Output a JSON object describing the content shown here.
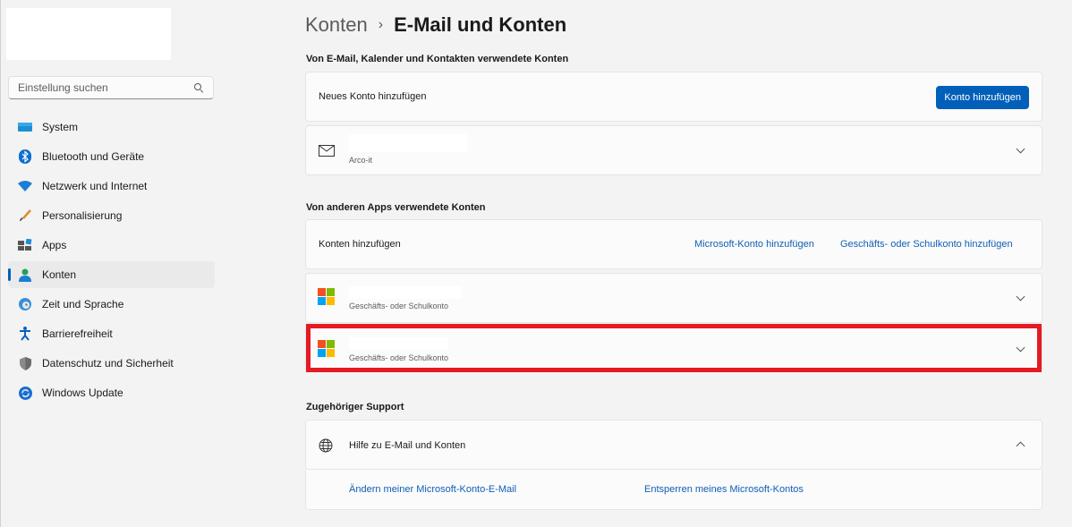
{
  "sidebar": {
    "search_placeholder": "Einstellung suchen",
    "items": [
      {
        "label": "System",
        "icon": "monitor-icon"
      },
      {
        "label": "Bluetooth und Geräte",
        "icon": "bluetooth-icon"
      },
      {
        "label": "Netzwerk und Internet",
        "icon": "wifi-icon"
      },
      {
        "label": "Personalisierung",
        "icon": "brush-icon"
      },
      {
        "label": "Apps",
        "icon": "apps-icon"
      },
      {
        "label": "Konten",
        "icon": "person-icon",
        "active": true
      },
      {
        "label": "Zeit und Sprache",
        "icon": "globe-clock-icon"
      },
      {
        "label": "Barrierefreiheit",
        "icon": "accessibility-icon"
      },
      {
        "label": "Datenschutz und Sicherheit",
        "icon": "shield-icon"
      },
      {
        "label": "Windows Update",
        "icon": "update-icon"
      }
    ]
  },
  "header": {
    "parent": "Konten",
    "separator": "›",
    "current": "E-Mail und Konten"
  },
  "sections": {
    "email_accounts_title": "Von E-Mail, Kalender und Kontakten verwendete Konten",
    "other_apps_title": "Von anderen Apps verwendete Konten",
    "support_title": "Zugehöriger Support"
  },
  "email": {
    "add_label": "Neues Konto hinzufügen",
    "add_button": "Konto hinzufügen",
    "account_sub": "Arco-it"
  },
  "other_apps": {
    "add_label": "Konten hinzufügen",
    "ms_link": "Microsoft-Konto hinzufügen",
    "work_link": "Geschäfts- oder Schulkonto hinzufügen",
    "account1_sub": "Geschäfts- oder Schulkonto",
    "account2_sub": "Geschäfts- oder Schulkonto"
  },
  "support": {
    "help_label": "Hilfe zu E-Mail und Konten",
    "link1": "Ändern meiner Microsoft-Konto-E-Mail",
    "link2": "Entsperren meines Microsoft-Kontos"
  },
  "colors": {
    "accent": "#005fb8",
    "highlight": "#e51a22",
    "link": "#0f5fb5"
  }
}
